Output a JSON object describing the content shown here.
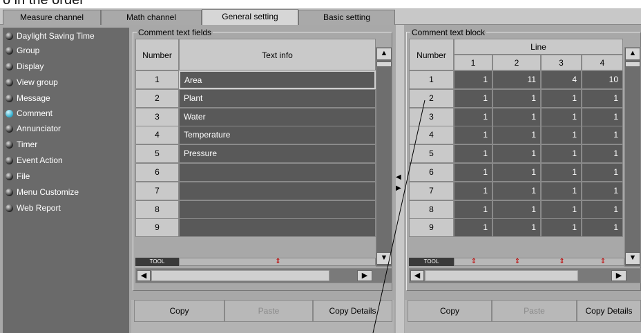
{
  "window": {
    "title_partial": "o in the order"
  },
  "tabs": [
    {
      "label": "Measure channel"
    },
    {
      "label": "Math channel"
    },
    {
      "label": "General setting"
    },
    {
      "label": "Basic setting"
    }
  ],
  "sidebar": {
    "items": [
      {
        "label": "Daylight Saving Time"
      },
      {
        "label": "Group"
      },
      {
        "label": "Display"
      },
      {
        "label": "View group"
      },
      {
        "label": "Message"
      },
      {
        "label": "Comment"
      },
      {
        "label": "Annunciator"
      },
      {
        "label": "Timer"
      },
      {
        "label": "Event Action"
      },
      {
        "label": "File"
      },
      {
        "label": "Menu Customize"
      },
      {
        "label": "Web Report"
      }
    ],
    "active": "Comment"
  },
  "fields": {
    "legend": "Comment text fields",
    "col_number": "Number",
    "col_text": "Text info",
    "rows": [
      {
        "num": "1",
        "text": "Area"
      },
      {
        "num": "2",
        "text": "Plant"
      },
      {
        "num": "3",
        "text": "Water"
      },
      {
        "num": "4",
        "text": "Temperature"
      },
      {
        "num": "5",
        "text": "Pressure"
      },
      {
        "num": "6",
        "text": ""
      },
      {
        "num": "7",
        "text": ""
      },
      {
        "num": "8",
        "text": ""
      },
      {
        "num": "9",
        "text": ""
      }
    ],
    "tool_label": "TOOL",
    "buttons": {
      "copy": "Copy",
      "paste": "Paste",
      "copy_details": "Copy Details"
    }
  },
  "block": {
    "legend": "Comment text block",
    "col_number": "Number",
    "col_line": "Line",
    "line_cols": [
      "1",
      "2",
      "3",
      "4"
    ],
    "rows": [
      {
        "num": "1",
        "v": [
          "1",
          "11",
          "4",
          "10"
        ]
      },
      {
        "num": "2",
        "v": [
          "1",
          "1",
          "1",
          "1"
        ]
      },
      {
        "num": "3",
        "v": [
          "1",
          "1",
          "1",
          "1"
        ]
      },
      {
        "num": "4",
        "v": [
          "1",
          "1",
          "1",
          "1"
        ]
      },
      {
        "num": "5",
        "v": [
          "1",
          "1",
          "1",
          "1"
        ]
      },
      {
        "num": "6",
        "v": [
          "1",
          "1",
          "1",
          "1"
        ]
      },
      {
        "num": "7",
        "v": [
          "1",
          "1",
          "1",
          "1"
        ]
      },
      {
        "num": "8",
        "v": [
          "1",
          "1",
          "1",
          "1"
        ]
      },
      {
        "num": "9",
        "v": [
          "1",
          "1",
          "1",
          "1"
        ]
      }
    ],
    "tool_label": "TOOL",
    "buttons": {
      "copy": "Copy",
      "paste": "Paste",
      "copy_details": "Copy Details"
    }
  },
  "icons": {
    "up": "▲",
    "down": "▼",
    "left": "◀",
    "right": "▶",
    "mark": "⇕"
  },
  "colors": {
    "active_dot": "#2aa9c9",
    "cell": "#595959"
  }
}
